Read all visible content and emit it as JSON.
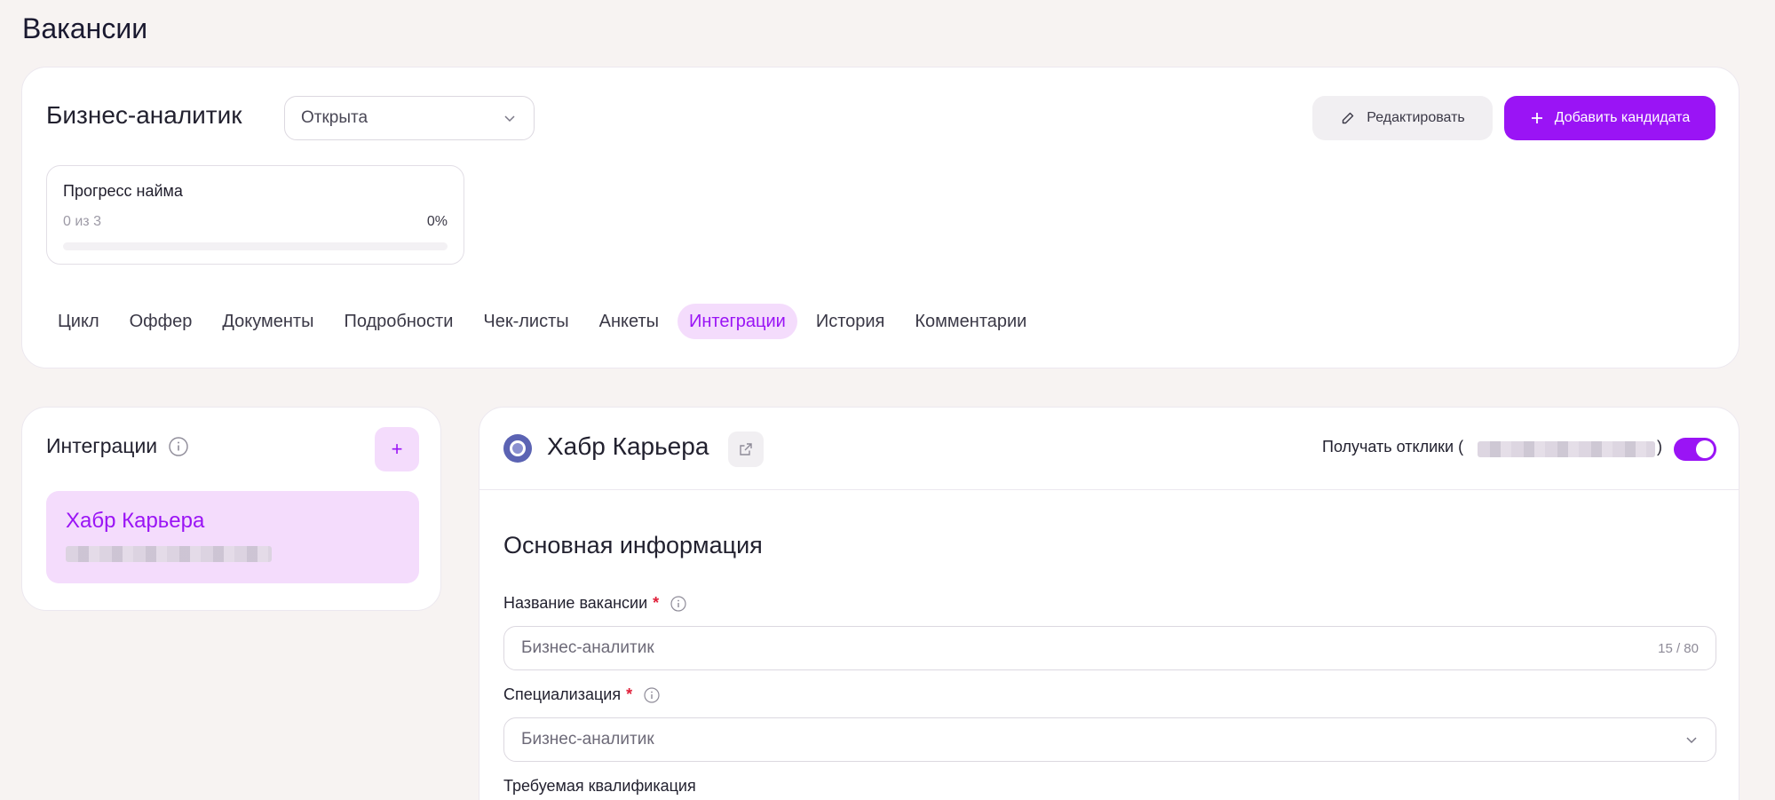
{
  "page": {
    "title": "Вакансии"
  },
  "vacancy": {
    "name": "Бизнес-аналитик",
    "status": "Открыта",
    "edit_label": "Редактировать",
    "add_candidate_label": "Добавить кандидата"
  },
  "progress": {
    "title": "Прогресс найма",
    "count": "0 из 3",
    "percent": "0%",
    "fraction": 0
  },
  "tabs": [
    {
      "label": "Цикл",
      "active": false
    },
    {
      "label": "Оффер",
      "active": false
    },
    {
      "label": "Документы",
      "active": false
    },
    {
      "label": "Подробности",
      "active": false
    },
    {
      "label": "Чек-листы",
      "active": false
    },
    {
      "label": "Анкеты",
      "active": false
    },
    {
      "label": "Интеграции",
      "active": true
    },
    {
      "label": "История",
      "active": false
    },
    {
      "label": "Комментарии",
      "active": false
    }
  ],
  "integrations": {
    "title": "Интеграции",
    "add_label": "+",
    "items": [
      {
        "name": "Хабр Карьера"
      }
    ]
  },
  "detail": {
    "name": "Хабр Карьера",
    "receive_label": "Получать отклики (",
    "receive_close": ")",
    "receive_enabled": true,
    "section_title": "Основная информация",
    "fields": {
      "title_label": "Название вакансии",
      "title_value": "Бизнес-аналитик",
      "title_counter": "15 / 80",
      "spec_label": "Специализация",
      "spec_value": "Бизнес-аналитик",
      "qual_label": "Требуемая квалификация"
    }
  },
  "colors": {
    "accent": "#9a14f5",
    "accent_soft": "#f4dcfc",
    "required": "#e0203a"
  }
}
